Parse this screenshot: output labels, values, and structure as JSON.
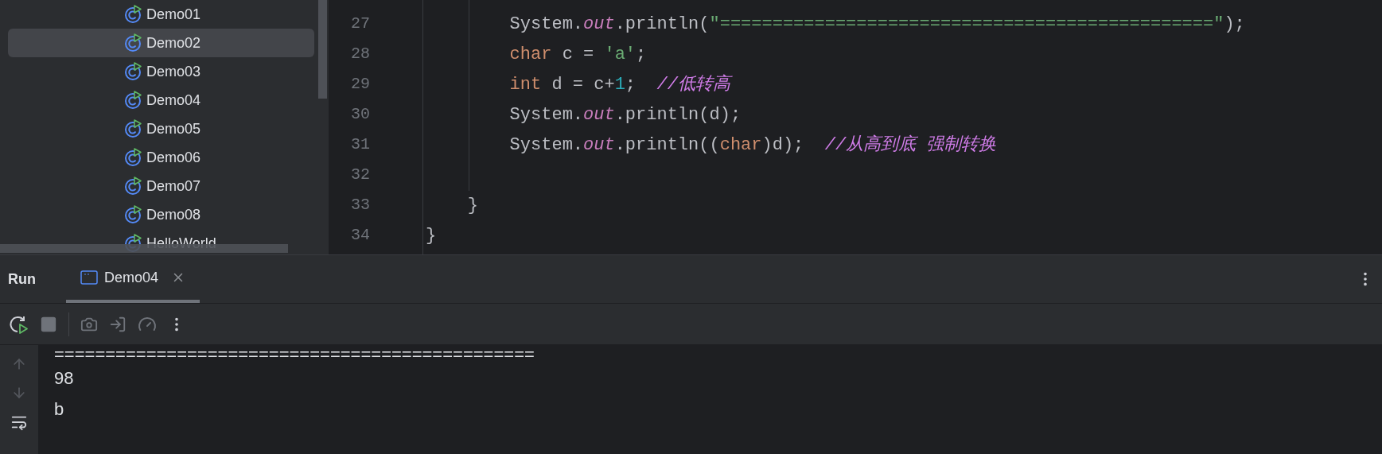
{
  "project_tree": {
    "items": [
      {
        "label": "Demo01",
        "selected": false
      },
      {
        "label": "Demo02",
        "selected": true
      },
      {
        "label": "Demo03",
        "selected": false
      },
      {
        "label": "Demo04",
        "selected": false
      },
      {
        "label": "Demo05",
        "selected": false
      },
      {
        "label": "Demo06",
        "selected": false
      },
      {
        "label": "Demo07",
        "selected": false
      },
      {
        "label": "Demo08",
        "selected": false
      },
      {
        "label": "HelloWorld",
        "selected": false
      }
    ]
  },
  "editor": {
    "lines": [
      {
        "number": "27",
        "tokens": [
          {
            "kind": "plain",
            "text": "        System."
          },
          {
            "kind": "field",
            "text": "out"
          },
          {
            "kind": "plain",
            "text": ".println("
          },
          {
            "kind": "string",
            "text": "\"===============================================\""
          },
          {
            "kind": "plain",
            "text": ");"
          }
        ]
      },
      {
        "number": "28",
        "tokens": [
          {
            "kind": "keyword",
            "text": "        char"
          },
          {
            "kind": "plain",
            "text": " c = "
          },
          {
            "kind": "string",
            "text": "'a'"
          },
          {
            "kind": "plain",
            "text": ";"
          }
        ]
      },
      {
        "number": "29",
        "tokens": [
          {
            "kind": "keyword",
            "text": "        int"
          },
          {
            "kind": "plain",
            "text": " d = c+"
          },
          {
            "kind": "number",
            "text": "1"
          },
          {
            "kind": "plain",
            "text": ";  "
          },
          {
            "kind": "comment",
            "text": "//低转高"
          }
        ]
      },
      {
        "number": "30",
        "tokens": [
          {
            "kind": "plain",
            "text": "        System."
          },
          {
            "kind": "field",
            "text": "out"
          },
          {
            "kind": "plain",
            "text": ".println(d);"
          }
        ]
      },
      {
        "number": "31",
        "tokens": [
          {
            "kind": "plain",
            "text": "        System."
          },
          {
            "kind": "field",
            "text": "out"
          },
          {
            "kind": "plain",
            "text": ".println(("
          },
          {
            "kind": "keyword",
            "text": "char"
          },
          {
            "kind": "plain",
            "text": ")d);  "
          },
          {
            "kind": "comment",
            "text": "//从高到底 强制转换"
          }
        ]
      },
      {
        "number": "32"
      },
      {
        "number": "33",
        "tokens": [
          {
            "kind": "plain",
            "text": "    }"
          }
        ]
      },
      {
        "number": "34",
        "tokens": [
          {
            "kind": "plain",
            "text": "}"
          }
        ]
      }
    ]
  },
  "run_panel": {
    "title": "Run",
    "tabs": [
      {
        "label": "Demo04",
        "selected": true
      }
    ],
    "console": {
      "lines": [
        "===============================================",
        "98",
        "b"
      ]
    }
  }
}
